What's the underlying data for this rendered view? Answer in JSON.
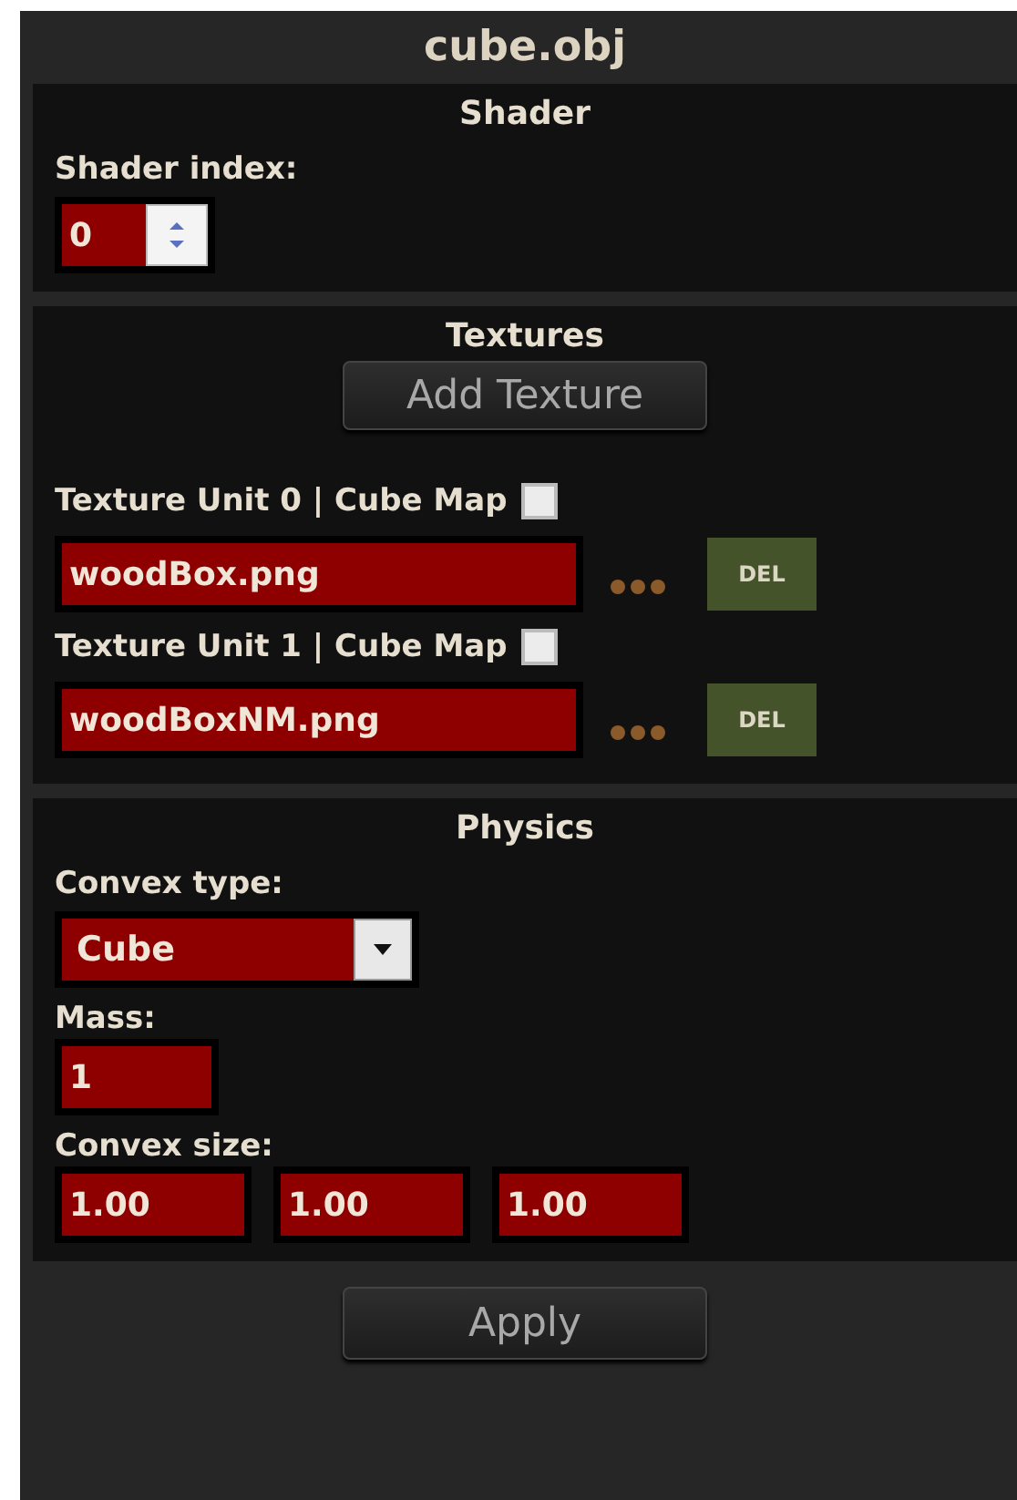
{
  "window": {
    "title": "cube.obj"
  },
  "shader": {
    "heading": "Shader",
    "label": "Shader index:",
    "value": "0"
  },
  "textures": {
    "heading": "Textures",
    "add_button": "Add Texture",
    "units": [
      {
        "label": "Texture Unit 0 | Cube Map",
        "cube_map": false,
        "file": "woodBox.png",
        "delete": "DEL"
      },
      {
        "label": "Texture Unit 1 | Cube Map",
        "cube_map": false,
        "file": "woodBoxNM.png",
        "delete": "DEL"
      }
    ]
  },
  "physics": {
    "heading": "Physics",
    "convex_type_label": "Convex type:",
    "convex_type": "Cube",
    "mass_label": "Mass:",
    "mass": "1",
    "convex_size_label": "Convex size:",
    "convex_size": [
      "1.00",
      "1.00",
      "1.00"
    ]
  },
  "apply_button": "Apply"
}
